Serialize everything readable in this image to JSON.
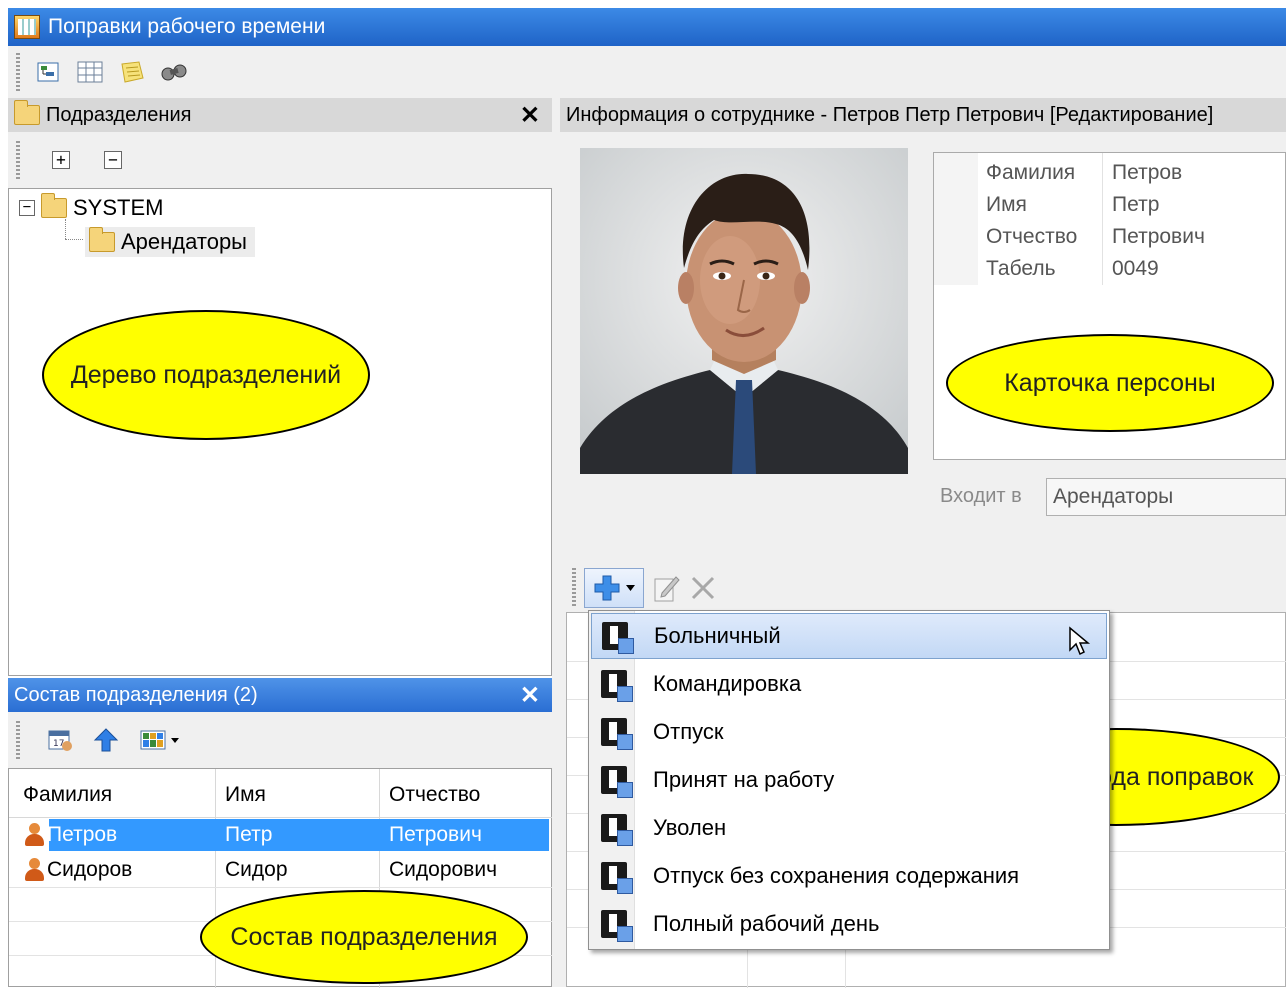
{
  "window": {
    "title": "Поправки рабочего времени"
  },
  "toolbar": {
    "icons": [
      "tree-view-icon",
      "table-icon",
      "notes-icon",
      "binoculars-icon"
    ]
  },
  "departments_panel": {
    "title": "Подразделения",
    "close_glyph": "✕",
    "expand_glyph": "+",
    "collapse_glyph": "−",
    "tree": [
      {
        "label": "SYSTEM",
        "toggle": "−"
      },
      {
        "label": "Арендаторы"
      }
    ],
    "annotation": "Дерево подразделений"
  },
  "members_panel": {
    "title": "Состав подразделения (2)",
    "close_glyph": "✕",
    "columns": [
      "Фамилия",
      "Имя",
      "Отчество"
    ],
    "rows": [
      {
        "last": "Петров",
        "first": "Петр",
        "middle": "Петрович",
        "selected": true
      },
      {
        "last": "Сидоров",
        "first": "Сидор",
        "middle": "Сидорович",
        "selected": false
      }
    ],
    "annotation": "Состав подразделения"
  },
  "info_panel": {
    "title": "Информация о сотруднике - Петров Петр Петрович [Редактирование]",
    "fields": [
      {
        "label": "Фамилия",
        "value": "Петров"
      },
      {
        "label": "Имя",
        "value": "Петр"
      },
      {
        "label": "Отчество",
        "value": "Петрович"
      },
      {
        "label": "Табель",
        "value": "0049"
      }
    ],
    "member_of_label": "Входит в",
    "member_of_value": "Арендаторы",
    "card_annotation": "Карточка персоны"
  },
  "corrections_panel": {
    "menu_items": [
      "Больничный",
      "Командировка",
      "Отпуск",
      "Принят на работу",
      "Уволен",
      "Отпуск без сохранения содержания",
      "Полный рабочий день"
    ],
    "selected_index": 0,
    "annotation": "Панель ввода поправок"
  },
  "colors": {
    "titlebar": "#2a72d8",
    "selection": "#3399ff",
    "annotation": "#ffff00"
  }
}
